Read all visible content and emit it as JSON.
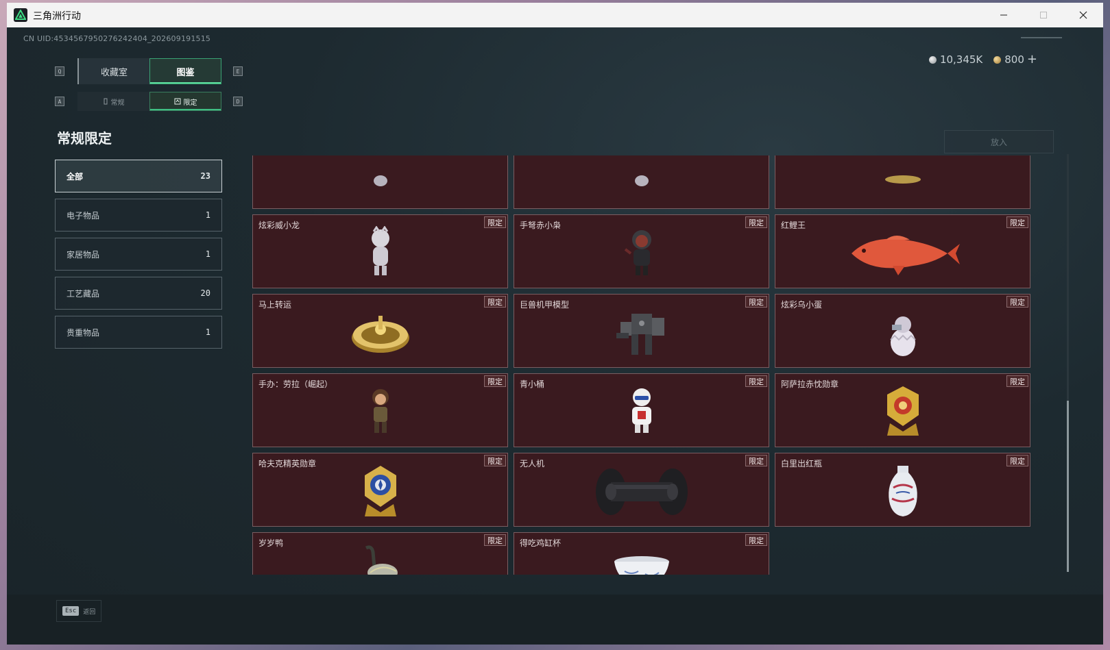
{
  "window": {
    "title": "三角洲行动"
  },
  "header": {
    "uid": "CN UID:4534567950276242404_202609191515",
    "currency_silver": "10,345K",
    "currency_gold": "800",
    "plus": "+"
  },
  "key_hints": {
    "q": "Q",
    "e": "E",
    "a": "A",
    "d": "D"
  },
  "tabs_main": [
    {
      "label": "收藏室",
      "active": false
    },
    {
      "label": "图鉴",
      "active": true
    }
  ],
  "tabs_sub": [
    {
      "label": "常规",
      "active": false
    },
    {
      "label": "限定",
      "active": true
    }
  ],
  "section_title": "常规限定",
  "categories": [
    {
      "label": "全部",
      "count": "23",
      "active": true
    },
    {
      "label": "电子物品",
      "count": "1",
      "active": false
    },
    {
      "label": "家居物品",
      "count": "1",
      "active": false
    },
    {
      "label": "工艺藏品",
      "count": "20",
      "active": false
    },
    {
      "label": "贵重物品",
      "count": "1",
      "active": false
    }
  ],
  "put_button": "放入",
  "badge_label": "限定",
  "items": [
    {
      "name": "",
      "icon": "figure-partial-icon"
    },
    {
      "name": "",
      "icon": "figure-partial-icon"
    },
    {
      "name": "",
      "icon": "gold-partial-icon"
    },
    {
      "name": "炫彩威小龙",
      "icon": "dragon-figure-icon"
    },
    {
      "name": "手弩赤小枭",
      "icon": "hooded-figure-icon"
    },
    {
      "name": "红鲤王",
      "icon": "koi-fish-icon"
    },
    {
      "name": "马上转运",
      "icon": "gold-roulette-icon"
    },
    {
      "name": "巨兽机甲模型",
      "icon": "mech-model-icon"
    },
    {
      "name": "炫彩乌小蛋",
      "icon": "egg-figure-icon"
    },
    {
      "name": "手办：劳拉（崛起）",
      "icon": "lara-figure-icon"
    },
    {
      "name": "青小桶",
      "icon": "robot-figure-icon"
    },
    {
      "name": "阿萨拉赤忱勋章",
      "icon": "gold-medal-icon"
    },
    {
      "name": "哈夫克精英勋章",
      "icon": "blue-medal-icon"
    },
    {
      "name": "无人机",
      "icon": "drone-roller-icon"
    },
    {
      "name": "白里出红瓶",
      "icon": "porcelain-vase-icon"
    },
    {
      "name": "岁岁鸭",
      "icon": "bronze-duck-icon"
    },
    {
      "name": "得吃鸡缸杯",
      "icon": "porcelain-cup-icon"
    }
  ],
  "bottom": {
    "esc_key": "Esc",
    "esc_label": "返回"
  }
}
